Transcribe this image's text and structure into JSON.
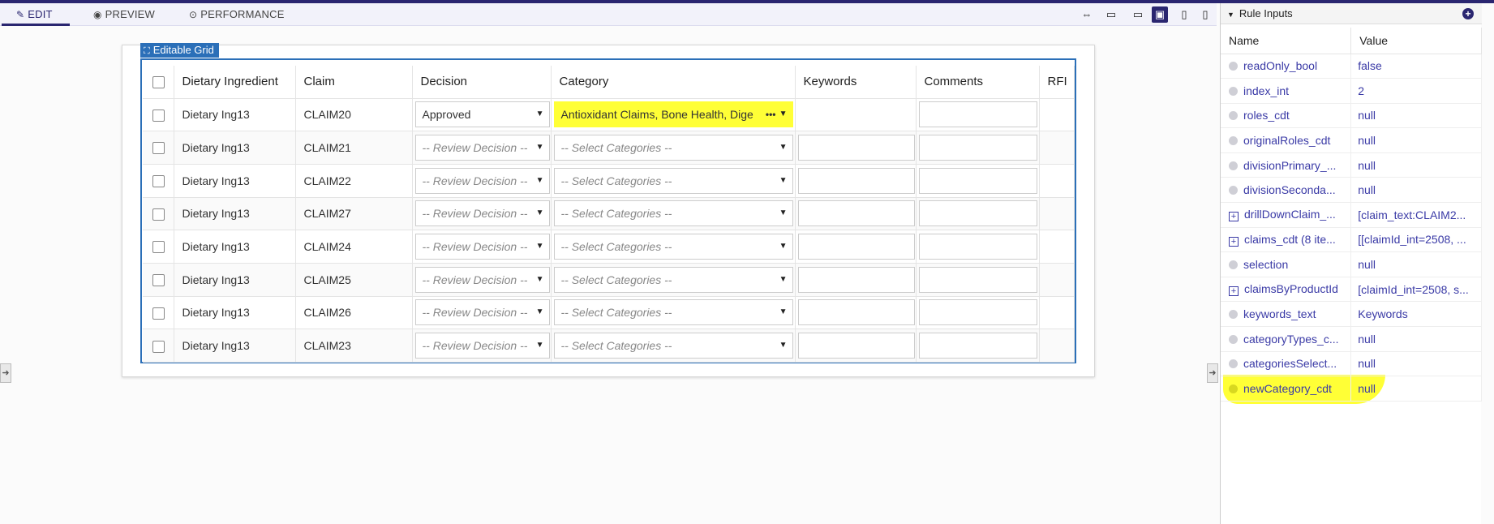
{
  "toolbar": {
    "tabs": [
      {
        "label": "EDIT",
        "icon": "pencil-icon"
      },
      {
        "label": "PREVIEW",
        "icon": "eye-icon"
      },
      {
        "label": "PERFORMANCE",
        "icon": "gauge-icon"
      }
    ],
    "active_tab": "EDIT",
    "device_icons": [
      "fit-width-icon",
      "desktop-large-icon",
      "desktop-icon",
      "monitor-icon",
      "tablet-icon",
      "phone-icon"
    ],
    "active_device": "monitor-icon"
  },
  "grid": {
    "label": "Editable Grid",
    "columns": [
      "Dietary Ingredient",
      "Claim",
      "Decision",
      "Category",
      "Keywords",
      "Comments",
      "RFI"
    ],
    "rows": [
      {
        "ingredient": "Dietary Ing13",
        "claim": "CLAIM20",
        "decision": "Approved",
        "category": "Antioxidant Claims, Bone Health, Dige",
        "category_highlighted": true,
        "keywords_editable": false
      },
      {
        "ingredient": "Dietary Ing13",
        "claim": "CLAIM21",
        "decision": "-- Review Decision --",
        "category": "-- Select Categories --"
      },
      {
        "ingredient": "Dietary Ing13",
        "claim": "CLAIM22",
        "decision": "-- Review Decision --",
        "category": "-- Select Categories --"
      },
      {
        "ingredient": "Dietary Ing13",
        "claim": "CLAIM27",
        "decision": "-- Review Decision --",
        "category": "-- Select Categories --"
      },
      {
        "ingredient": "Dietary Ing13",
        "claim": "CLAIM24",
        "decision": "-- Review Decision --",
        "category": "-- Select Categories --"
      },
      {
        "ingredient": "Dietary Ing13",
        "claim": "CLAIM25",
        "decision": "-- Review Decision --",
        "category": "-- Select Categories --"
      },
      {
        "ingredient": "Dietary Ing13",
        "claim": "CLAIM26",
        "decision": "-- Review Decision --",
        "category": "-- Select Categories --"
      },
      {
        "ingredient": "Dietary Ing13",
        "claim": "CLAIM23",
        "decision": "-- Review Decision --",
        "category": "-- Select Categories --"
      }
    ]
  },
  "rule_inputs": {
    "title": "Rule Inputs",
    "headers": {
      "name": "Name",
      "value": "Value"
    },
    "items": [
      {
        "name": "readOnly_bool",
        "value": "false",
        "expandable": false
      },
      {
        "name": "index_int",
        "value": "2",
        "expandable": false
      },
      {
        "name": "roles_cdt",
        "value": "null",
        "expandable": false
      },
      {
        "name": "originalRoles_cdt",
        "value": "null",
        "expandable": false
      },
      {
        "name": "divisionPrimary_...",
        "value": "null",
        "expandable": false
      },
      {
        "name": "divisionSeconda...",
        "value": "null",
        "expandable": false
      },
      {
        "name": "drillDownClaim_...",
        "value": "[claim_text:CLAIM2...",
        "expandable": true
      },
      {
        "name": "claims_cdt (8 ite...",
        "value": "[[claimId_int=2508, ...",
        "expandable": true
      },
      {
        "name": "selection",
        "value": "null",
        "expandable": false
      },
      {
        "name": "claimsByProductId",
        "value": "[claimId_int=2508, s...",
        "expandable": true
      },
      {
        "name": "keywords_text",
        "value": "Keywords",
        "expandable": false
      },
      {
        "name": "categoryTypes_c...",
        "value": "null",
        "expandable": false
      },
      {
        "name": "categoriesSelect...",
        "value": "null",
        "expandable": false
      },
      {
        "name": "newCategory_cdt",
        "value": "null",
        "expandable": false,
        "highlighted": true
      }
    ]
  },
  "colors": {
    "accent": "#2a2670",
    "grid_blue": "#2b6fb8",
    "highlight": "#ffff36"
  }
}
